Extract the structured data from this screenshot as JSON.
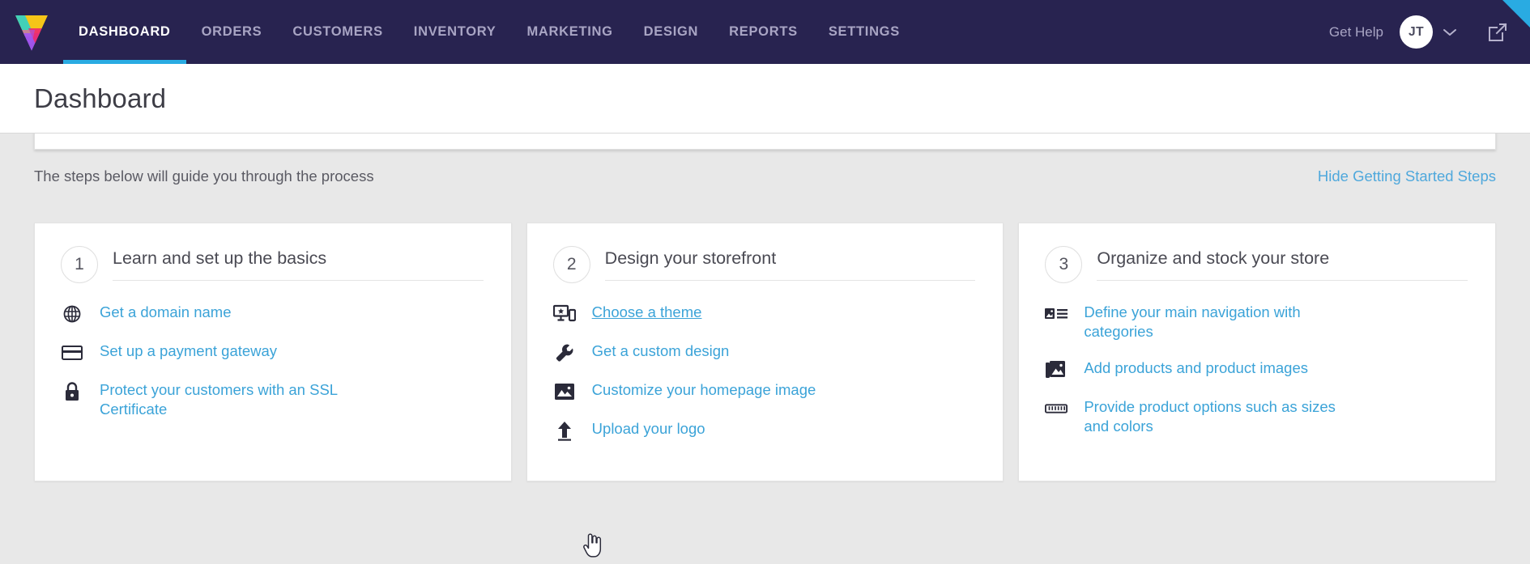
{
  "topnav": {
    "logo_name": "brand-logo",
    "items": [
      {
        "label": "DASHBOARD",
        "active": true
      },
      {
        "label": "ORDERS",
        "active": false
      },
      {
        "label": "CUSTOMERS",
        "active": false
      },
      {
        "label": "INVENTORY",
        "active": false
      },
      {
        "label": "MARKETING",
        "active": false
      },
      {
        "label": "DESIGN",
        "active": false
      },
      {
        "label": "REPORTS",
        "active": false
      },
      {
        "label": "SETTINGS",
        "active": false
      }
    ],
    "get_help": "Get Help",
    "avatar_initials": "JT",
    "caret_icon": "chevron-down-icon",
    "external_link_icon": "external-link-icon",
    "accent_color": "#29abe2",
    "bar_color": "#282350"
  },
  "page": {
    "title": "Dashboard"
  },
  "getting_started": {
    "note": "The steps below will guide you through the process",
    "hide_link": "Hide Getting Started Steps",
    "link_color": "#4fa8dc"
  },
  "cards": [
    {
      "number": "1",
      "title": "Learn and set up the basics",
      "links": [
        {
          "icon": "globe-icon",
          "label": "Get a domain name",
          "hover": false
        },
        {
          "icon": "credit-card-icon",
          "label": "Set up a payment gateway",
          "hover": false
        },
        {
          "icon": "lock-icon",
          "label": "Protect your customers with an SSL Certificate",
          "hover": false
        }
      ]
    },
    {
      "number": "2",
      "title": "Design your storefront",
      "links": [
        {
          "icon": "responsive-devices-icon",
          "label": "Choose a theme",
          "hover": true
        },
        {
          "icon": "wrench-icon",
          "label": "Get a custom design",
          "hover": false
        },
        {
          "icon": "image-icon",
          "label": "Customize your homepage image",
          "hover": false
        },
        {
          "icon": "upload-icon",
          "label": "Upload your logo",
          "hover": false
        }
      ]
    },
    {
      "number": "3",
      "title": "Organize and stock your store",
      "links": [
        {
          "icon": "navigation-list-icon",
          "label": "Define your main navigation with categories",
          "hover": false
        },
        {
          "icon": "photos-icon",
          "label": "Add products and product images",
          "hover": false
        },
        {
          "icon": "ruler-icon",
          "label": "Provide product options such as sizes and colors",
          "hover": false
        }
      ]
    }
  ],
  "cursor": {
    "icon": "pointer-hand-cursor"
  }
}
